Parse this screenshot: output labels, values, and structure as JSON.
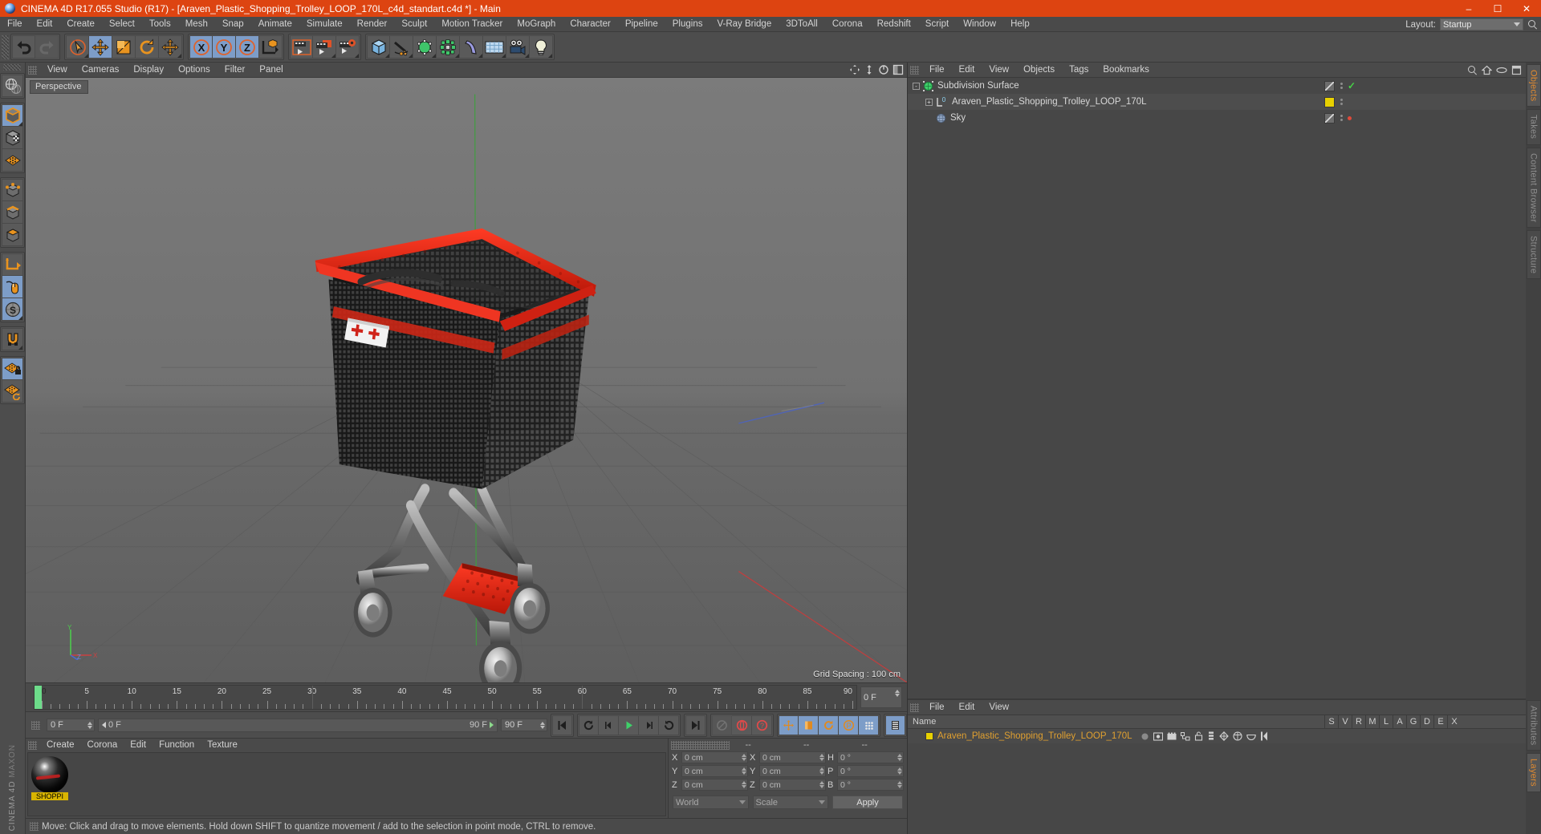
{
  "titlebar": {
    "title": "CINEMA 4D R17.055 Studio (R17) - [Araven_Plastic_Shopping_Trolley_LOOP_170L_c4d_standart.c4d *] - Main",
    "minimize": "–",
    "maximize": "☐",
    "close": "✕"
  },
  "menubar": {
    "items": [
      "File",
      "Edit",
      "Create",
      "Select",
      "Tools",
      "Mesh",
      "Snap",
      "Animate",
      "Simulate",
      "Render",
      "Sculpt",
      "Motion Tracker",
      "MoGraph",
      "Character",
      "Pipeline",
      "Plugins",
      "V-Ray Bridge",
      "3DToAll",
      "Corona",
      "Redshift",
      "Script",
      "Window",
      "Help"
    ],
    "layout_label": "Layout:",
    "layout_value": "Startup"
  },
  "toolbar": {
    "groups": [
      {
        "buttons": [
          {
            "name": "undo-icon",
            "state": "normal"
          },
          {
            "name": "redo-icon",
            "state": "disabled"
          }
        ]
      },
      {
        "buttons": [
          {
            "name": "live-selection-icon",
            "state": "normal",
            "corner": true
          },
          {
            "name": "move-tool-icon",
            "state": "active"
          },
          {
            "name": "scale-tool-icon",
            "state": "normal"
          },
          {
            "name": "rotate-tool-icon",
            "state": "normal"
          },
          {
            "name": "move-alt-icon",
            "state": "normal",
            "corner": true
          }
        ]
      },
      {
        "buttons": [
          {
            "name": "axis-x-icon",
            "state": "active"
          },
          {
            "name": "axis-y-icon",
            "state": "active"
          },
          {
            "name": "axis-z-icon",
            "state": "active"
          },
          {
            "name": "world-coordinate-icon",
            "state": "normal"
          }
        ]
      },
      {
        "buttons": [
          {
            "name": "render-view-icon",
            "state": "normal"
          },
          {
            "name": "render-region-icon",
            "state": "normal",
            "corner": true
          },
          {
            "name": "render-settings-icon",
            "state": "normal",
            "corner": true
          }
        ]
      },
      {
        "buttons": [
          {
            "name": "cube-primitive-icon",
            "state": "normal",
            "corner": true
          },
          {
            "name": "spline-pen-icon",
            "state": "normal",
            "corner": true
          },
          {
            "name": "generator-icon",
            "state": "normal",
            "corner": true
          },
          {
            "name": "mograph-cloner-icon",
            "state": "normal",
            "corner": true
          },
          {
            "name": "deformer-bend-icon",
            "state": "normal",
            "corner": true
          },
          {
            "name": "scene-floor-icon",
            "state": "normal",
            "corner": true
          },
          {
            "name": "camera-icon",
            "state": "normal",
            "corner": true
          },
          {
            "name": "light-icon",
            "state": "normal",
            "corner": true
          }
        ]
      }
    ]
  },
  "leftbar": {
    "groups": [
      {
        "buttons": [
          {
            "name": "texture-axis-icon",
            "state": "normal"
          }
        ]
      },
      {
        "buttons": [
          {
            "name": "model-mode-icon",
            "state": "active",
            "corner": true
          },
          {
            "name": "texture-mode-icon",
            "state": "normal"
          },
          {
            "name": "workplane-mode-icon",
            "state": "normal"
          }
        ]
      },
      {
        "buttons": [
          {
            "name": "points-mode-icon",
            "state": "normal"
          },
          {
            "name": "edges-mode-icon",
            "state": "normal"
          },
          {
            "name": "polygons-mode-icon",
            "state": "normal"
          }
        ]
      },
      {
        "buttons": [
          {
            "name": "object-axis-icon",
            "state": "normal"
          },
          {
            "name": "viewport-solo-icon",
            "state": "active"
          },
          {
            "name": "enable-axis-icon",
            "state": "active",
            "corner": true
          }
        ]
      },
      {
        "buttons": [
          {
            "name": "snap-magnet-icon",
            "state": "normal",
            "corner": true
          }
        ]
      },
      {
        "buttons": [
          {
            "name": "workplane-lock-icon",
            "state": "active"
          },
          {
            "name": "workplane-rotate-icon",
            "state": "normal"
          }
        ]
      }
    ],
    "brand_line1": "CINEMA 4D",
    "brand_line2": "MAXON"
  },
  "viewport": {
    "menu": [
      "View",
      "Cameras",
      "Display",
      "Options",
      "Filter",
      "Panel"
    ],
    "tag": "Perspective",
    "grid_spacing": "Grid Spacing : 100 cm",
    "axis_x": "X",
    "axis_y": "Y",
    "axis_z": "Z",
    "icons": [
      "pan-view-icon",
      "zoom-view-icon",
      "rotate-view-icon",
      "maximize-view-icon"
    ]
  },
  "timeline": {
    "ticks": [
      0,
      5,
      10,
      15,
      20,
      25,
      30,
      35,
      40,
      45,
      50,
      55,
      60,
      65,
      70,
      75,
      80,
      85,
      90
    ],
    "current_frame": "0 F",
    "current_frame_field": "0 F",
    "range_start": "0 F",
    "range_end": "90 F",
    "end_frame_field": "90 F"
  },
  "playbar": {
    "transport": [
      {
        "name": "go-to-start-icon",
        "state": "normal"
      },
      {
        "name": "previous-keyframe-icon",
        "state": "normal"
      },
      {
        "name": "step-back-icon",
        "state": "normal"
      },
      {
        "name": "play-icon",
        "state": "normal"
      },
      {
        "name": "step-forward-icon",
        "state": "normal"
      },
      {
        "name": "next-keyframe-icon",
        "state": "normal"
      },
      {
        "name": "go-to-end-icon",
        "state": "normal"
      }
    ],
    "record": [
      {
        "name": "autokey-icon",
        "state": "disabled"
      },
      {
        "name": "record-active-objects-icon",
        "state": "normal"
      },
      {
        "name": "keyframe-selection-icon",
        "state": "normal"
      }
    ],
    "keyflags": [
      {
        "name": "key-position-icon",
        "state": "active"
      },
      {
        "name": "key-scale-icon",
        "state": "active"
      },
      {
        "name": "key-rotation-icon",
        "state": "active"
      },
      {
        "name": "key-parameter-icon",
        "state": "active"
      },
      {
        "name": "key-pla-icon",
        "state": "active"
      },
      {
        "name": "timeline-toggle-icon",
        "state": "active"
      }
    ]
  },
  "material_manager": {
    "menu": [
      "Create",
      "Corona",
      "Edit",
      "Function",
      "Texture"
    ],
    "materials": [
      {
        "name": "SHOPPI"
      }
    ]
  },
  "coordinates": {
    "headers": [
      "--",
      "--",
      "--"
    ],
    "rows": [
      {
        "axis1": "X",
        "val1": "0 cm",
        "axis2": "X",
        "val2": "0 cm",
        "axis3": "H",
        "val3": "0 °"
      },
      {
        "axis1": "Y",
        "val1": "0 cm",
        "axis2": "Y",
        "val2": "0 cm",
        "axis3": "P",
        "val3": "0 °"
      },
      {
        "axis1": "Z",
        "val1": "0 cm",
        "axis2": "Z",
        "val2": "0 cm",
        "axis3": "B",
        "val3": "0 °"
      }
    ],
    "system": "World",
    "mode": "Scale",
    "apply": "Apply"
  },
  "statusbar": {
    "text": "Move: Click and drag to move elements. Hold down SHIFT to quantize movement / add to the selection in point mode, CTRL to remove."
  },
  "object_manager": {
    "menu": [
      "File",
      "Edit",
      "View",
      "Objects",
      "Tags",
      "Bookmarks"
    ],
    "icons": [
      "search-icon",
      "home-icon",
      "eye-icon",
      "fit-icon"
    ],
    "rows": [
      {
        "label": "Subdivision Surface",
        "indent": 0,
        "icon": "subdivision-surface-icon",
        "expander": "-",
        "swatch": "diag",
        "mark": "check"
      },
      {
        "label": "Araven_Plastic_Shopping_Trolley_LOOP_170L",
        "indent": 1,
        "icon": "null-object-icon",
        "expander": "+",
        "swatch": "yellow",
        "mark": "none"
      },
      {
        "label": "Sky",
        "indent": 1,
        "icon": "sky-object-icon",
        "expander": "",
        "swatch": "diag",
        "mark": "reddot"
      }
    ],
    "tabs": [
      "Objects",
      "Takes",
      "Content Browser",
      "Structure"
    ],
    "active_tab": "Objects"
  },
  "bottom_right": {
    "menu": [
      "File",
      "Edit",
      "View"
    ],
    "name_header": "Name",
    "columns": [
      "S",
      "V",
      "R",
      "M",
      "L",
      "A",
      "G",
      "D",
      "E",
      "X"
    ],
    "row_label": "Araven_Plastic_Shopping_Trolley_LOOP_170L",
    "tabs": [
      "Attributes",
      "Layers"
    ],
    "active_tab": "Layers"
  },
  "colors": {
    "title_orange": "#dd4411",
    "accent_orange": "#e08a30",
    "panel_bg": "#4a4a4a",
    "button_active": "#7d9dc8",
    "viewport_bg": "#6b6b6b",
    "cart_red": "#e2291c",
    "cart_dark": "#2a2a2a"
  }
}
